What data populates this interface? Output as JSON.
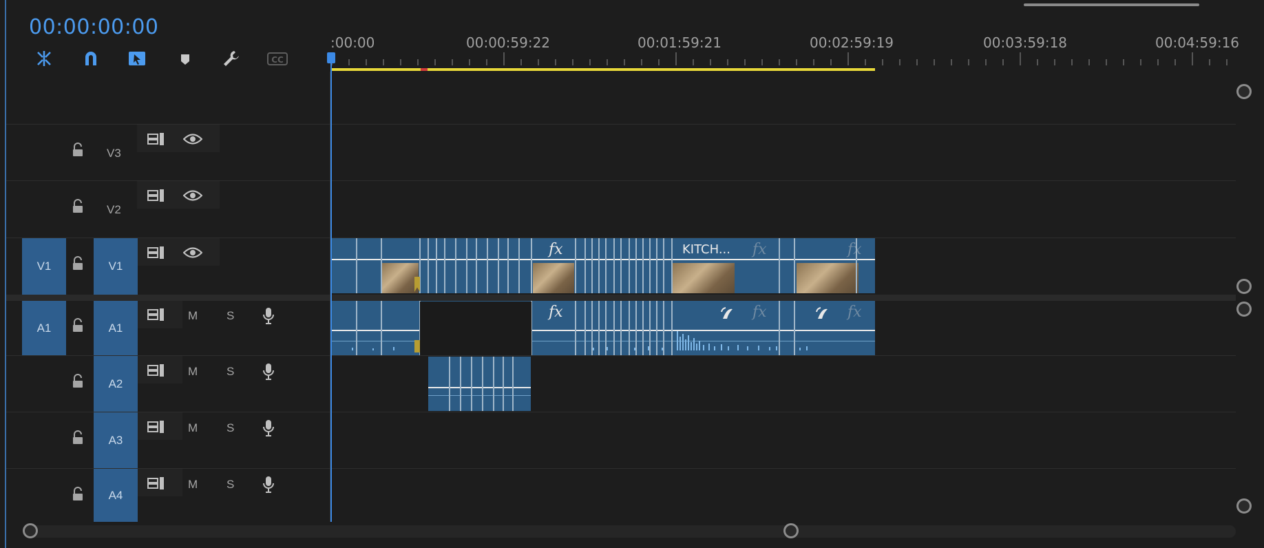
{
  "timecode": "00:00:00:00",
  "toolbar": {
    "tools": [
      {
        "name": "insert-overwrite-icon"
      },
      {
        "name": "snap-magnet-icon"
      },
      {
        "name": "linked-selection-icon"
      },
      {
        "name": "add-marker-icon"
      },
      {
        "name": "settings-wrench-icon"
      },
      {
        "name": "closed-captions-icon",
        "label": "CC"
      }
    ]
  },
  "ruler": {
    "timecodes": [
      ":00:00",
      "00:00:59:22",
      "00:01:59:21",
      "00:02:59:19",
      "00:03:59:18",
      "00:04:59:16"
    ]
  },
  "tracks": {
    "video": [
      {
        "id": "V3",
        "target": "",
        "toggle": "eye"
      },
      {
        "id": "V2",
        "target": "",
        "toggle": "eye"
      },
      {
        "id": "V1",
        "target": "V1",
        "toggle": "eye"
      }
    ],
    "audio": [
      {
        "id": "A1",
        "target": "A1",
        "mute": "M",
        "solo": "S"
      },
      {
        "id": "A2",
        "target": "",
        "mute": "M",
        "solo": "S"
      },
      {
        "id": "A3",
        "target": "",
        "mute": "M",
        "solo": "S"
      },
      {
        "id": "A4",
        "target": "",
        "mute": "M",
        "solo": "S"
      }
    ]
  },
  "clips": {
    "fx_label": "fx",
    "kitchen_name": "KITCH..."
  },
  "colors": {
    "accent": "#4c9bef",
    "track_target": "#2e5e8e",
    "clip": "#2c5b84",
    "work_area": "#e7d83a"
  }
}
